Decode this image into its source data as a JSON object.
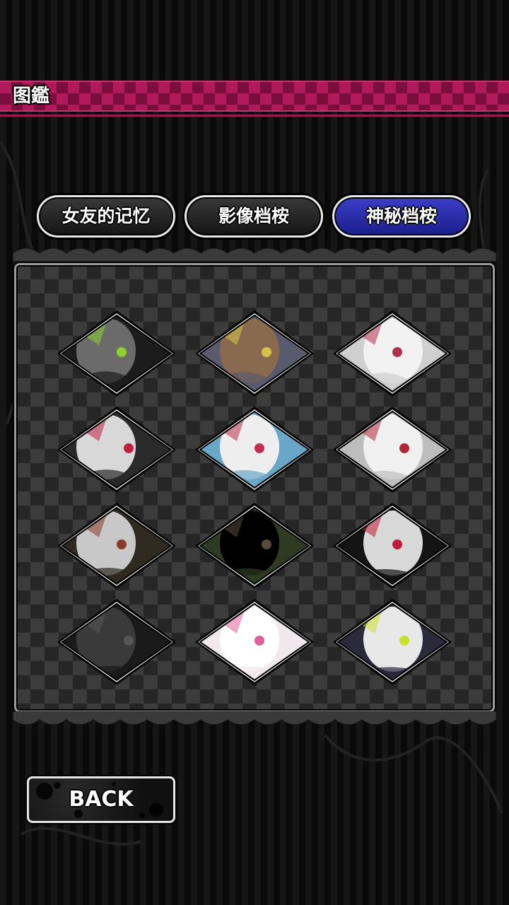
{
  "header": {
    "title": "图鑑"
  },
  "tabs": [
    {
      "label": "女友的记忆",
      "active": false
    },
    {
      "label": "影像档桉",
      "active": false
    },
    {
      "label": "神秘档桉",
      "active": true
    }
  ],
  "gallery": {
    "items": [
      {
        "name": "gallery-item-1",
        "theme": [
          "#1c1c1c",
          "#6b6b6b",
          "#8fd12c"
        ]
      },
      {
        "name": "gallery-item-2",
        "theme": [
          "#5a5a6e",
          "#8a6a4e",
          "#d9c24a"
        ]
      },
      {
        "name": "gallery-item-3",
        "theme": [
          "#cfcfcf",
          "#f2f2f2",
          "#b03050"
        ]
      },
      {
        "name": "gallery-item-4",
        "theme": [
          "#2a2a2a",
          "#d8d8d8",
          "#c02040"
        ]
      },
      {
        "name": "gallery-item-5",
        "theme": [
          "#6aa6c8",
          "#eeeeee",
          "#c0304a"
        ]
      },
      {
        "name": "gallery-item-6",
        "theme": [
          "#bdbdbd",
          "#f0f0f0",
          "#b02838"
        ]
      },
      {
        "name": "gallery-item-7",
        "theme": [
          "#2e2a20",
          "#c8c8c8",
          "#8a3a2a"
        ]
      },
      {
        "name": "gallery-item-8",
        "theme": [
          "#2f3a22",
          "#000000",
          "#5a4a3a"
        ]
      },
      {
        "name": "gallery-item-9",
        "theme": [
          "#141414",
          "#d8d8d8",
          "#c01c3a"
        ]
      },
      {
        "name": "gallery-item-10",
        "theme": [
          "#1a1a1a",
          "#3a3a3a",
          "#555555"
        ]
      },
      {
        "name": "gallery-item-11",
        "theme": [
          "#f0e8ec",
          "#ffffff",
          "#e0609a"
        ]
      },
      {
        "name": "gallery-item-12",
        "theme": [
          "#2a2a3a",
          "#e8e8e8",
          "#c8e02a"
        ]
      }
    ]
  },
  "back_button": {
    "label": "BACK"
  },
  "colors": {
    "accent": "#b01a5a",
    "active_tab": "#2b2fb0"
  }
}
